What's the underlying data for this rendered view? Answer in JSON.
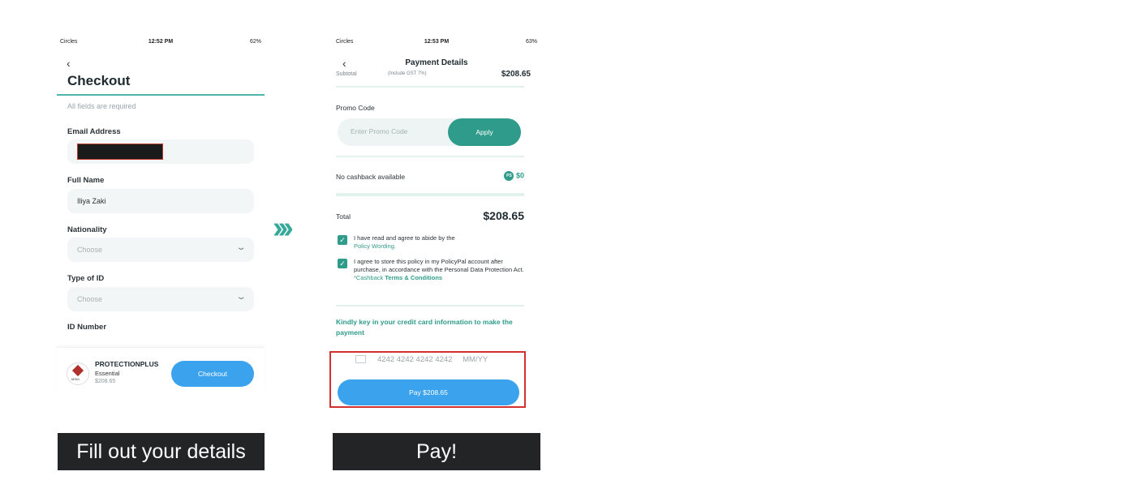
{
  "flow_arrows": "›››",
  "screen1": {
    "status": {
      "carrier": "Circles",
      "time": "12:52 PM",
      "battery": "62%"
    },
    "back_icon": "chevron-left",
    "title": "Checkout",
    "hint": "All fields are required",
    "email": {
      "label": "Email Address",
      "value": ""
    },
    "full_name": {
      "label": "Full Name",
      "value": "Iliya Zaki"
    },
    "nationality": {
      "label": "Nationality",
      "placeholder": "Choose"
    },
    "type_of_id": {
      "label": "Type of ID",
      "placeholder": "Choose"
    },
    "id_number": {
      "label": "ID Number"
    },
    "product": {
      "name": "PROTECTIONPLUS",
      "tier": "Essential",
      "price": "$208.65",
      "logo_text": "MSIG"
    },
    "checkout_button": "Checkout",
    "caption": "Fill out your details"
  },
  "screen2": {
    "status": {
      "carrier": "Circles",
      "time": "12:53 PM",
      "battery": "63%"
    },
    "title": "Payment Details",
    "subtotal": {
      "label": "Subtotal",
      "note": "(Include GST 7%)",
      "value": "$208.65"
    },
    "promo": {
      "label": "Promo Code",
      "placeholder": "Enter Promo Code",
      "button": "Apply"
    },
    "cashback": {
      "label": "No cashback available",
      "badge": "PS",
      "value": "$0"
    },
    "total": {
      "label": "Total",
      "value": "$208.65"
    },
    "agree1": {
      "text": "I have read and agree to abide by the",
      "link": "Policy Wording."
    },
    "agree2": {
      "text": "I agree to store this policy in my PolicyPal account after purchase, in accordance with the Personal Data Protection Act.",
      "prefix": "*Cashback",
      "link": "Terms & Conditions"
    },
    "card_prompt": "Kindly key in your credit card information to make the payment",
    "card": {
      "number": "4242 4242 4242 4242",
      "expiry": "MM/YY"
    },
    "pay_button": "Pay $208.65",
    "caption": "Pay!"
  },
  "colors": {
    "teal": "#2f9b8b",
    "blue": "#3ba3ee",
    "caption_bg": "#222426",
    "highlight_red": "#d33030"
  }
}
